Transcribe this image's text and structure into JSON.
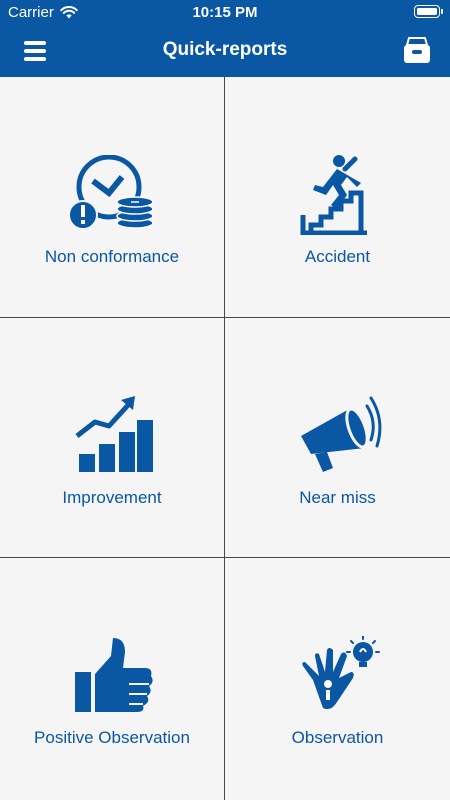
{
  "status_bar": {
    "carrier": "Carrier",
    "time": "10:15 PM"
  },
  "header": {
    "title": "Quick-reports"
  },
  "colors": {
    "brand": "#0a57a4",
    "background": "#f5f5f5",
    "divider": "#4a4a4a"
  },
  "tiles": [
    {
      "label": "Non conformance",
      "icon": "clock-coins-warning-icon"
    },
    {
      "label": "Accident",
      "icon": "falling-person-icon"
    },
    {
      "label": "Improvement",
      "icon": "growth-chart-icon"
    },
    {
      "label": "Near miss",
      "icon": "megaphone-icon"
    },
    {
      "label": "Positive Observation",
      "icon": "thumbs-up-icon"
    },
    {
      "label": "Observation",
      "icon": "hand-lightbulb-icon"
    }
  ]
}
